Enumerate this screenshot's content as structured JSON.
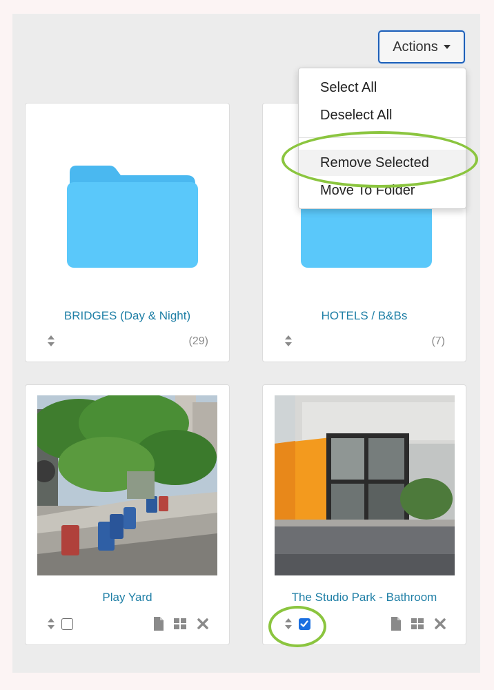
{
  "actions": {
    "label": "Actions",
    "menu": [
      "Select All",
      "Deselect All",
      "Remove Selected",
      "Move To Folder"
    ]
  },
  "folders": [
    {
      "title": "BRIDGES (Day & Night)",
      "count": "(29)"
    },
    {
      "title": "HOTELS / B&Bs",
      "count": "(7)"
    }
  ],
  "photos": [
    {
      "title": "Play Yard",
      "checked": false
    },
    {
      "title": "The Studio Park - Bathroom",
      "checked": true
    }
  ],
  "colors": {
    "link": "#1f7fa6",
    "folder": "#5ac8fa",
    "highlight_ring": "#8bc53f",
    "checkbox_checked": "#1a6fe0"
  },
  "icons": [
    "sort-icon",
    "file-icon",
    "grid-icon",
    "close-icon",
    "folder-icon",
    "caret-down-icon",
    "check-icon"
  ]
}
